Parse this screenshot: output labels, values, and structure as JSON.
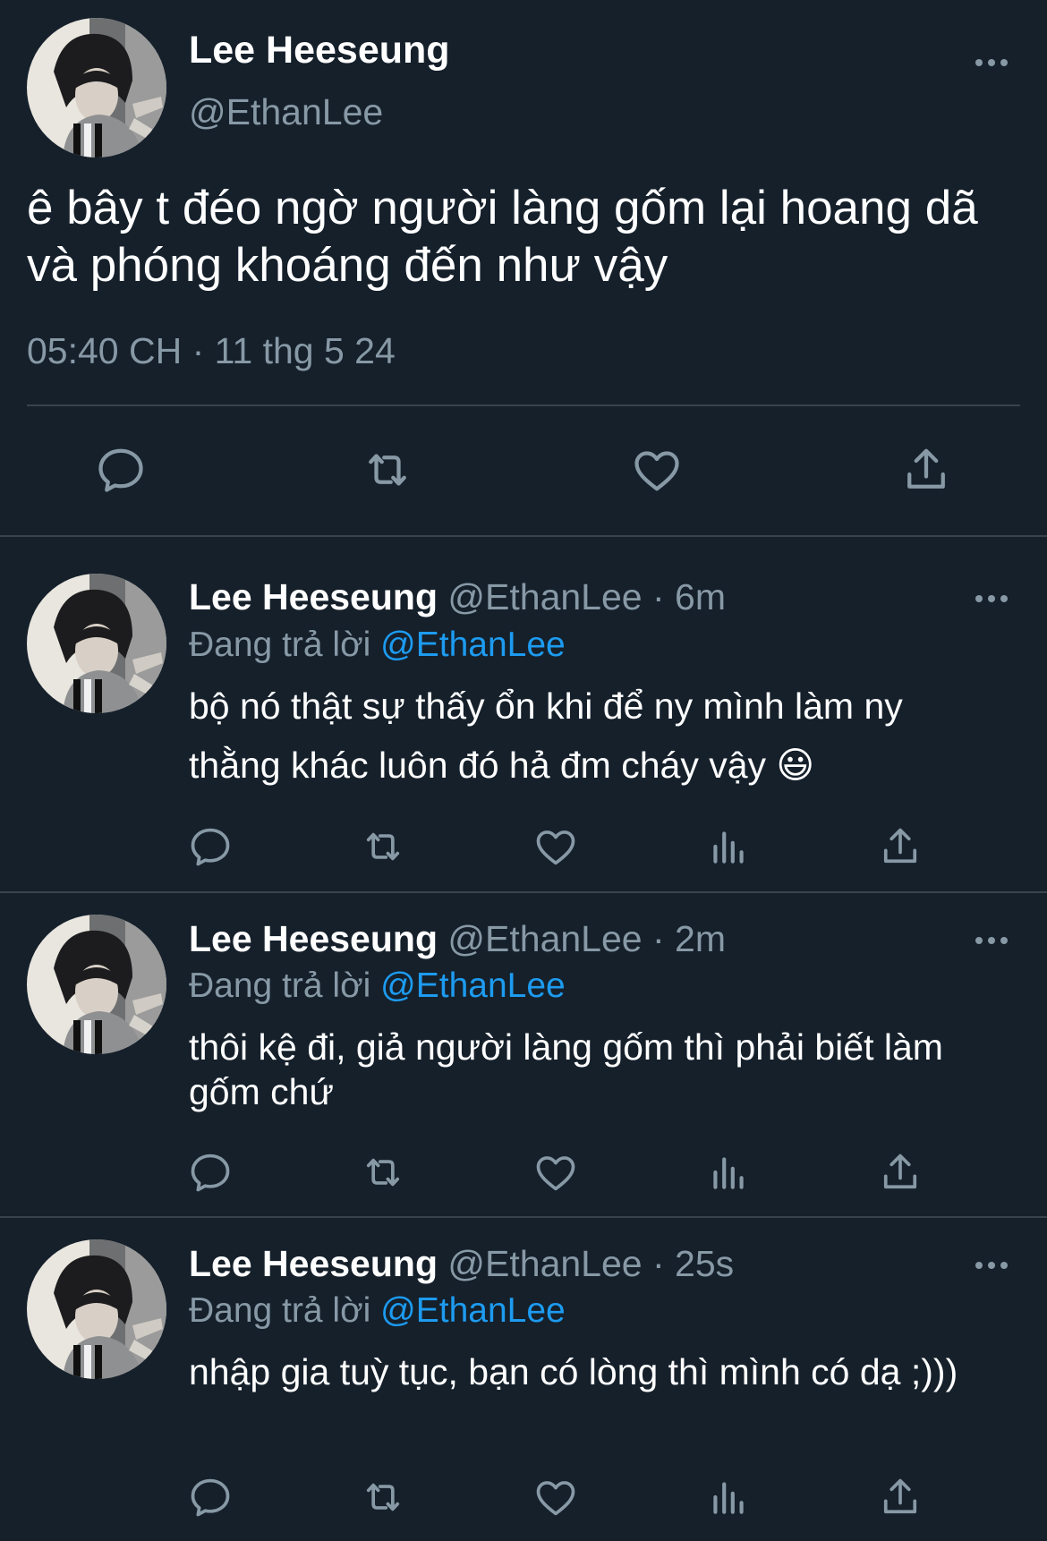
{
  "main_tweet": {
    "display_name": "Lee Heeseung",
    "handle": "@EthanLee",
    "text": "ê bây t đéo ngờ người làng gốm lại hoang dã và phóng khoáng đến như vậy",
    "timestamp": "05:40 CH · 11 thg 5 24",
    "actions": [
      "reply-icon",
      "retweet-icon",
      "like-icon",
      "share-icon"
    ]
  },
  "replies": [
    {
      "display_name": "Lee Heeseung",
      "handle": "@EthanLee",
      "sep": "·",
      "time": "6m",
      "replying_prefix": "Đang trả lời",
      "replying_to": "@EthanLee",
      "text": "bộ nó thật sự thấy ổn khi để ny mình làm ny thằng khác luôn đó hả đm cháy vậy 😃"
    },
    {
      "display_name": "Lee Heeseung",
      "handle": "@EthanLee",
      "sep": "·",
      "time": "2m",
      "replying_prefix": "Đang trả lời",
      "replying_to": "@EthanLee",
      "text": "thôi kệ đi, giả người làng gốm thì phải biết làm gốm chứ"
    },
    {
      "display_name": "Lee Heeseung",
      "handle": "@EthanLee",
      "sep": "·",
      "time": "25s",
      "replying_prefix": "Đang trả lời",
      "replying_to": "@EthanLee",
      "text": "nhập gia tuỳ tục, bạn có lòng thì mình có dạ ;)))"
    }
  ],
  "reply_actions": [
    "reply-icon",
    "retweet-icon",
    "like-icon",
    "views-icon",
    "share-icon"
  ],
  "colors": {
    "background": "#15202b",
    "text": "#ffffff",
    "muted": "#8899a6",
    "link": "#1d9bf0",
    "divider": "#38444d"
  }
}
